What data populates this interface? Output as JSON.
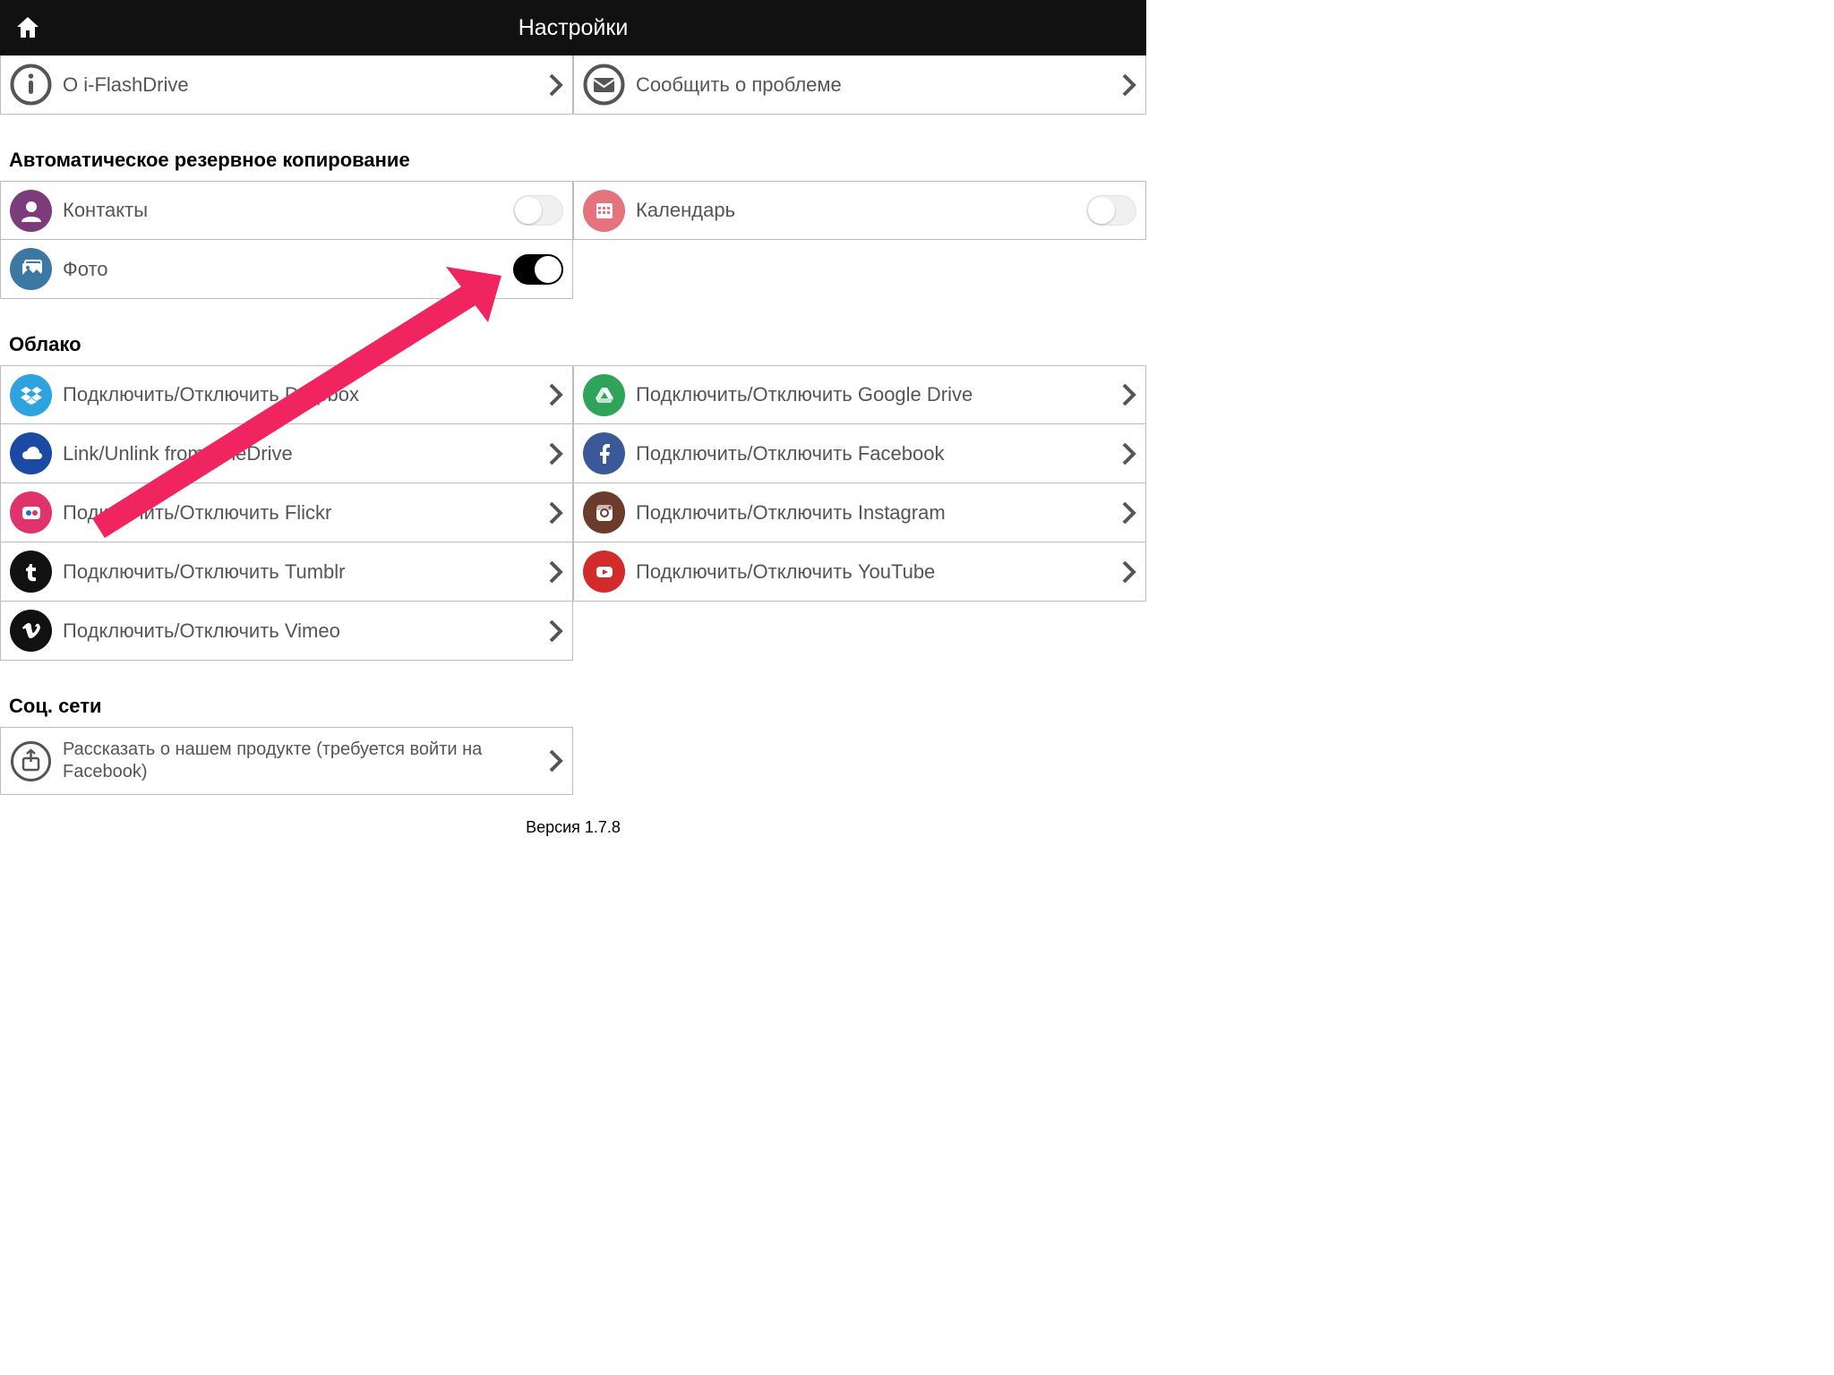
{
  "header": {
    "title": "Настройки"
  },
  "top": {
    "about_label": "О i-FlashDrive",
    "report_label": "Сообщить о проблеме"
  },
  "backup": {
    "section_title": "Автоматическое резервное копирование",
    "contacts_label": "Контакты",
    "contacts_on": false,
    "calendar_label": "Календарь",
    "calendar_on": false,
    "photo_label": "Фото",
    "photo_on": true
  },
  "cloud": {
    "section_title": "Облако",
    "dropbox": "Подключить/Отключить Dropbox",
    "gdrive": "Подключить/Отключить Google Drive",
    "onedrive": "Link/Unlink from OneDrive",
    "facebook": "Подключить/Отключить Facebook",
    "flickr": "Подключить/Отключить  Flickr",
    "instagram": "Подключить/Отключить Instagram",
    "tumblr": "Подключить/Отключить Tumblr",
    "youtube": "Подключить/Отключить YouTube",
    "vimeo": "Подключить/Отключить Vimeo"
  },
  "social": {
    "section_title": "Соц. сети",
    "share_label": "Рассказать о нашем продукте (требуется войти на Facebook)"
  },
  "footer": {
    "version": "Версия 1.7.8"
  },
  "colors": {
    "contacts": "#7c3b7a",
    "photo": "#3b78a3",
    "calendar": "#e5737e",
    "dropbox": "#2fa3e0",
    "gdrive": "#2fa35a",
    "onedrive": "#1a4aa3",
    "facebook": "#3b5998",
    "flickr": "#e0336b",
    "instagram": "#6b3b2c",
    "tumblr": "#111111",
    "youtube": "#d12b2b",
    "vimeo": "#111111",
    "info": "#555555",
    "mail": "#555555",
    "share": "#555555",
    "annotation_arrow": "#f0245e"
  }
}
